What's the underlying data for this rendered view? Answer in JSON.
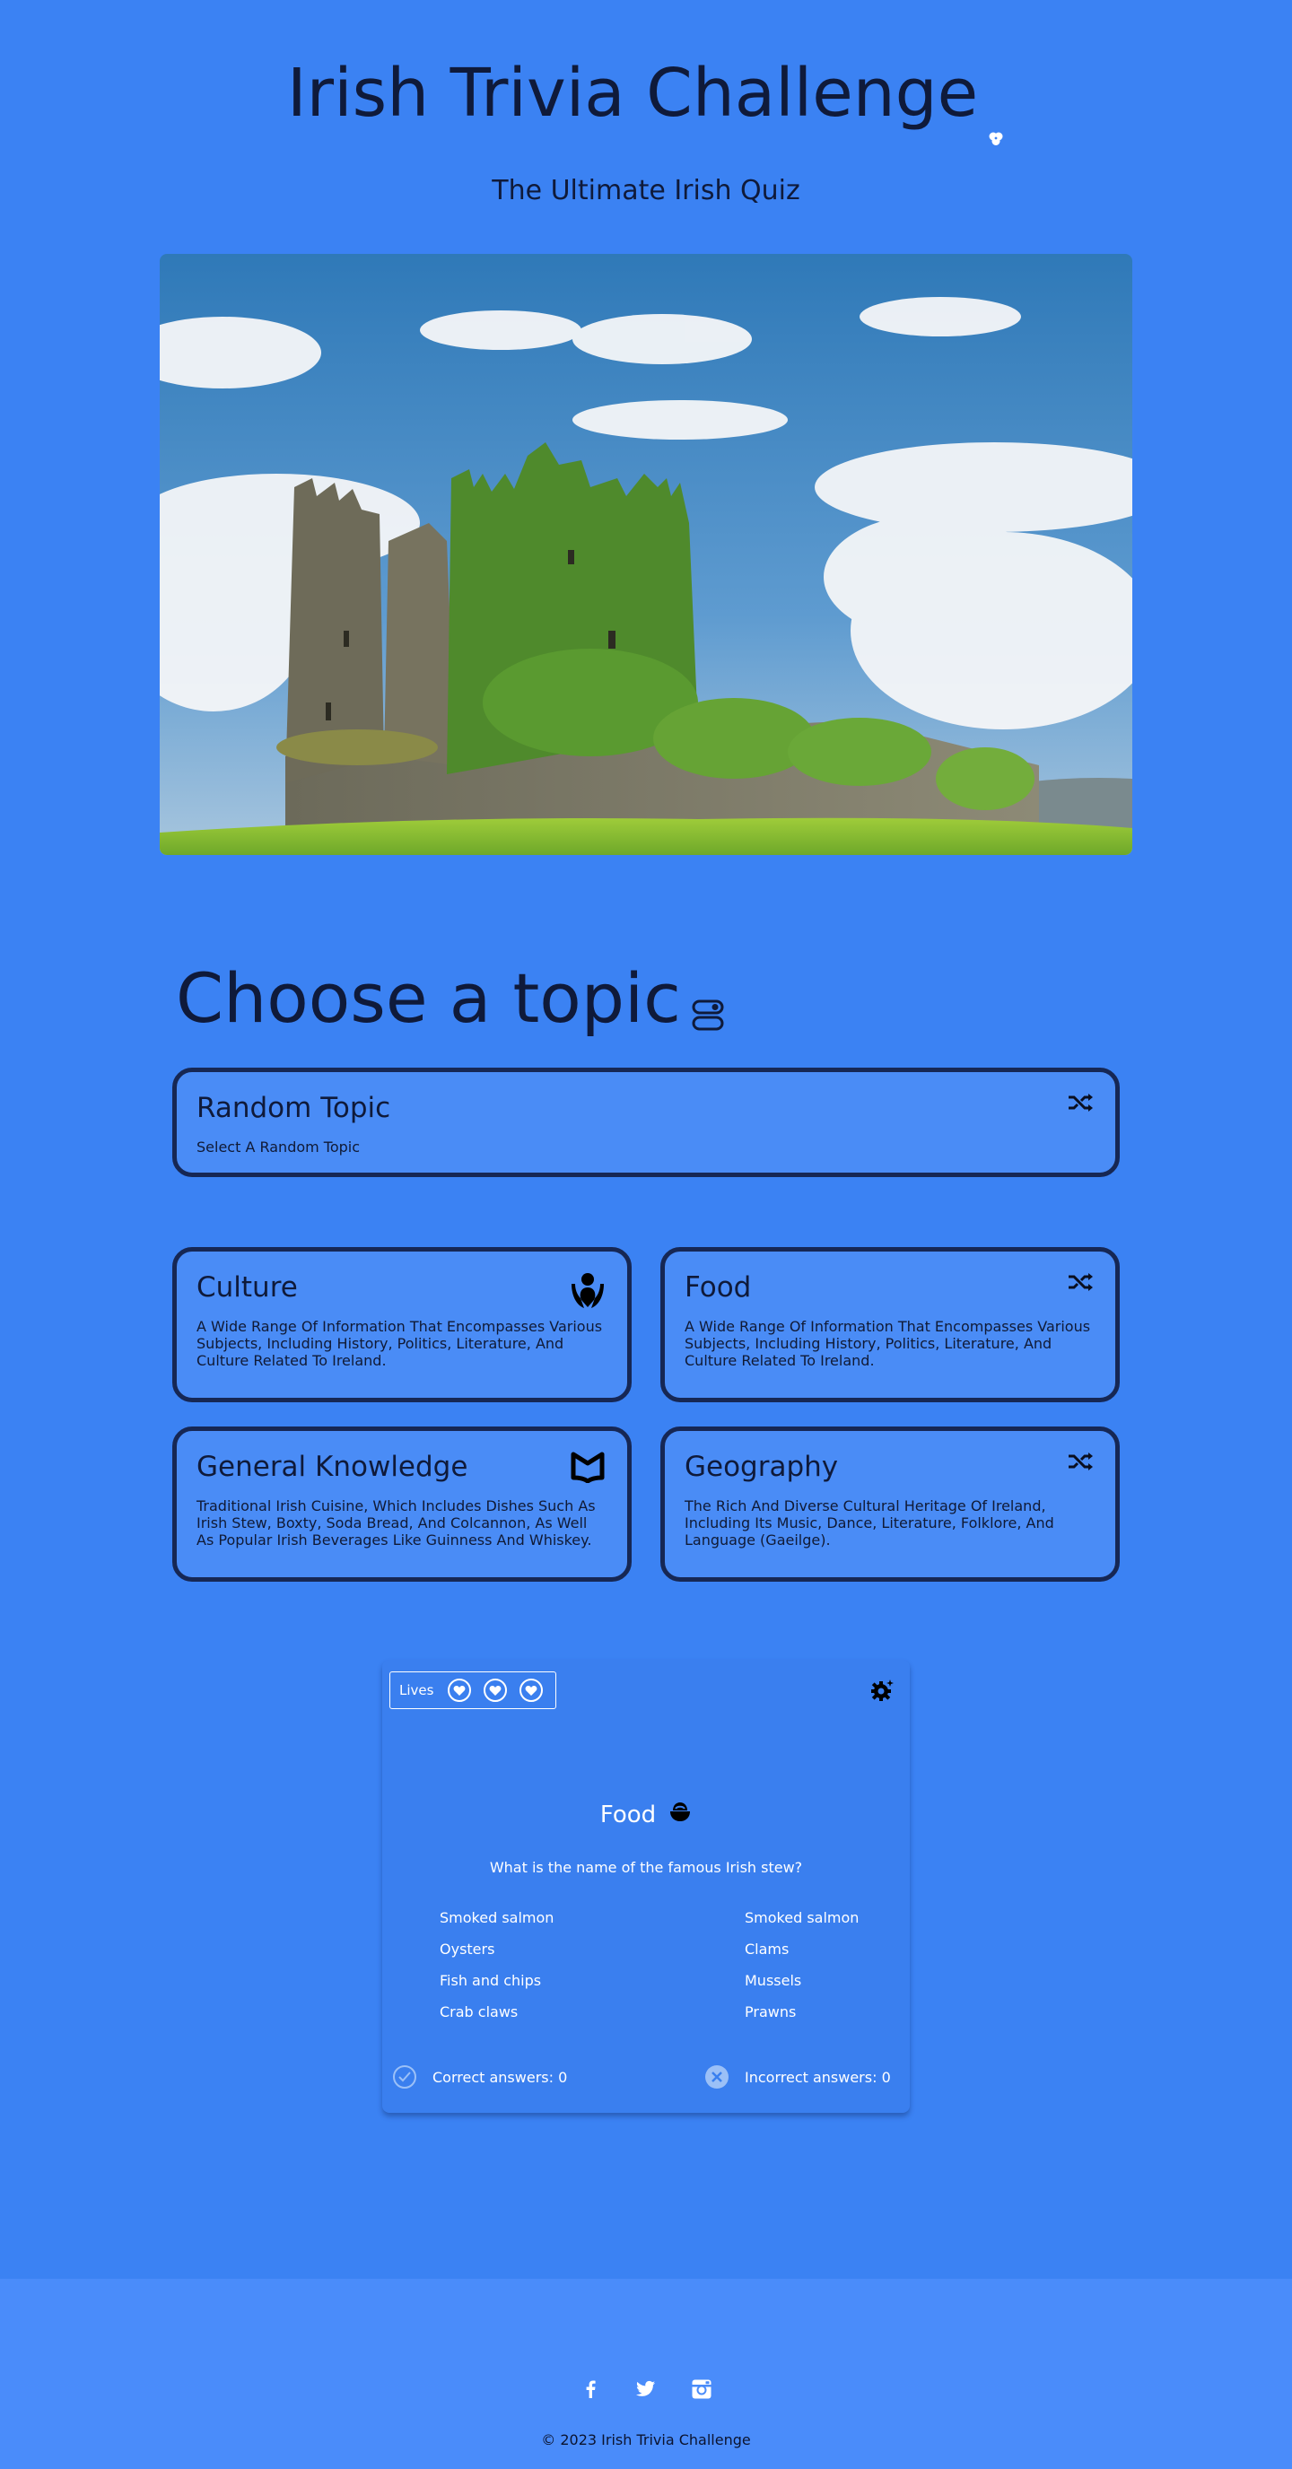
{
  "header": {
    "title": "Irish Trivia Challenge",
    "subtitle": "The Ultimate Irish Quiz"
  },
  "topics": {
    "heading": "Choose a topic",
    "random": {
      "title": "Random Topic",
      "description": "Select A Random Topic",
      "icon": "shuffle-icon"
    },
    "cards": [
      {
        "title": "Culture",
        "description": "A Wide Range Of Information That Encompasses Various Subjects, Including History, Politics, Literature, And Culture Related To Ireland.",
        "icon": "hands-person-icon"
      },
      {
        "title": "Food",
        "description": "A Wide Range Of Information That Encompasses Various Subjects, Including History, Politics, Literature, And Culture Related To Ireland.",
        "icon": "shuffle-icon"
      },
      {
        "title": "General Knowledge",
        "description": "Traditional Irish Cuisine, Which Includes Dishes Such As Irish Stew, Boxty, Soda Bread, And Colcannon, As Well As Popular Irish Beverages Like Guinness And Whiskey.",
        "icon": "book-icon"
      },
      {
        "title": "Geography",
        "description": "The Rich And Diverse Cultural Heritage Of Ireland, Including Its Music, Dance, Literature, Folklore, And Language (Gaeilge).",
        "icon": "shuffle-icon"
      }
    ]
  },
  "quiz": {
    "lives_label": "Lives",
    "lives": 3,
    "topic": "Food",
    "question": "What is the name of the famous Irish stew?",
    "answers_left": [
      "Smoked salmon",
      "Oysters",
      "Fish and chips",
      "Crab claws"
    ],
    "answers_right": [
      "Smoked salmon",
      "Clams",
      "Mussels",
      "Prawns"
    ],
    "correct_label": "Correct answers: 0",
    "incorrect_label": "Incorrect answers: 0"
  },
  "footer": {
    "social": [
      "facebook-icon",
      "twitter-icon",
      "instagram-icon"
    ],
    "copyright": "© 2023 Irish Trivia Challenge"
  },
  "colors": {
    "background": "#3b82f3",
    "card_border": "#162754",
    "card_fill": "#4a8cf6",
    "footer": "#4a8cfa",
    "text_dark": "#0f1a3a"
  }
}
